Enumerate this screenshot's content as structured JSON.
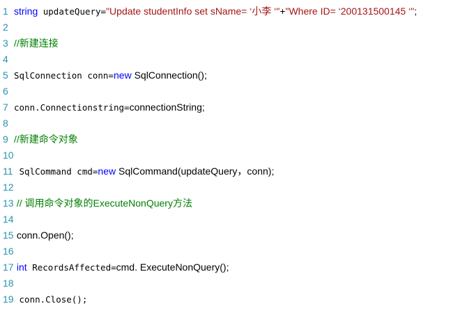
{
  "colors": {
    "background": "#ffffff",
    "line_number": "#2b91af",
    "keyword": "#0000ff",
    "string": "#a31515",
    "comment": "#008000",
    "text": "#000000"
  },
  "lines": [
    {
      "n": "1",
      "tokens": [
        {
          "t": "string",
          "k": "kw",
          "f": "sans"
        },
        {
          "t": " updateQuery=",
          "k": "tx",
          "f": "mono"
        },
        {
          "t": "\"Update studentInfo set sName= ‘小李 ‘\"",
          "k": "str",
          "f": "sans"
        },
        {
          "t": "+",
          "k": "tx",
          "f": "sans"
        },
        {
          "t": "\"Where ID= ‘200131500145 ‘\"",
          "k": "str",
          "f": "sans"
        },
        {
          "t": ";",
          "k": "tx",
          "f": "sans"
        }
      ]
    },
    {
      "n": "2",
      "tokens": []
    },
    {
      "n": "3",
      "tokens": [
        {
          "t": "//新建连接",
          "k": "cm",
          "f": ""
        }
      ]
    },
    {
      "n": "4",
      "tokens": []
    },
    {
      "n": "5",
      "tokens": [
        {
          "t": "SqlConnection conn=",
          "k": "tx",
          "f": "mono"
        },
        {
          "t": "new",
          "k": "kw",
          "f": "sans"
        },
        {
          "t": " SqlConnection();",
          "k": "tx",
          "f": "sans"
        }
      ]
    },
    {
      "n": "6",
      "tokens": []
    },
    {
      "n": "7",
      "tokens": [
        {
          "t": "conn.Connectionstring=",
          "k": "tx",
          "f": "mono"
        },
        {
          "t": "connectionString;",
          "k": "tx",
          "f": "sans"
        }
      ]
    },
    {
      "n": "8",
      "tokens": []
    },
    {
      "n": "9",
      "tokens": [
        {
          "t": "//新建命令对象",
          "k": "cm",
          "f": ""
        }
      ]
    },
    {
      "n": "10",
      "tokens": []
    },
    {
      "n": "11",
      "tokens": [
        {
          "t": " SqlCommand cmd=",
          "k": "tx",
          "f": "mono"
        },
        {
          "t": "new",
          "k": "kw",
          "f": "sans"
        },
        {
          "t": " SqlCommand(updateQuery，conn);",
          "k": "tx",
          "f": "sans"
        }
      ]
    },
    {
      "n": "12",
      "tokens": []
    },
    {
      "n": "13",
      "tokens": [
        {
          "t": " // 调用命令对象的ExecuteNonQuery方法",
          "k": "cm",
          "f": ""
        }
      ]
    },
    {
      "n": "14",
      "tokens": []
    },
    {
      "n": "15",
      "tokens": [
        {
          "t": " conn.Open();",
          "k": "tx",
          "f": "sans"
        }
      ]
    },
    {
      "n": "16",
      "tokens": []
    },
    {
      "n": "17",
      "tokens": [
        {
          "t": " int",
          "k": "kw",
          "f": "sans"
        },
        {
          "t": " RecordsAffected=",
          "k": "tx",
          "f": "mono"
        },
        {
          "t": "cmd. ExecuteNonQuery();",
          "k": "tx",
          "f": "sans"
        }
      ]
    },
    {
      "n": "18",
      "tokens": []
    },
    {
      "n": "19",
      "tokens": [
        {
          "t": " conn.Close();",
          "k": "tx",
          "f": "mono"
        }
      ]
    }
  ]
}
